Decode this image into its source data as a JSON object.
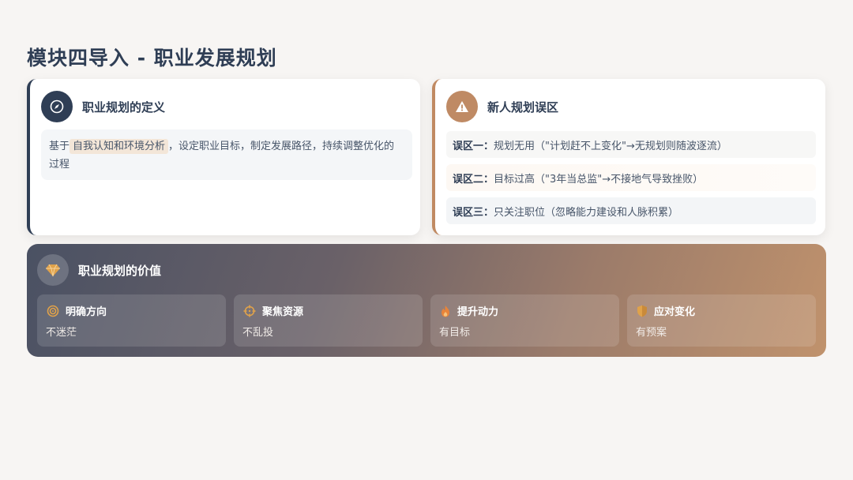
{
  "title": "模块四导入 - 职业发展规划",
  "definition": {
    "title": "职业规划的定义",
    "icon": "compass-icon",
    "text_before": "基于",
    "highlight": "自我认知和环境分析",
    "text_after": "，设定职业目标，制定发展路径，持续调整优化的过程"
  },
  "mistakes": {
    "title": "新人规划误区",
    "icon": "warning-icon",
    "items": [
      {
        "label": "误区一：",
        "text": "规划无用（\"计划赶不上变化\"→无规划则随波逐流）"
      },
      {
        "label": "误区二：",
        "text": "目标过高（\"3年当总监\"→不接地气导致挫败）"
      },
      {
        "label": "误区三：",
        "text": "只关注职位（忽略能力建设和人脉积累）"
      }
    ]
  },
  "value": {
    "title": "职业规划的价值",
    "icon": "gem-icon",
    "items": [
      {
        "title": "明确方向",
        "sub": "不迷茫",
        "icon": "target-icon"
      },
      {
        "title": "聚焦资源",
        "sub": "不乱投",
        "icon": "crosshair-icon"
      },
      {
        "title": "提升动力",
        "sub": "有目标",
        "icon": "flame-icon"
      },
      {
        "title": "应对变化",
        "sub": "有预案",
        "icon": "shield-icon"
      }
    ]
  },
  "colors": {
    "navy": "#2f3e55",
    "tan": "#bf8a64",
    "highlight_bg": "#f3e6d8",
    "icon_gold": "#e0a24a"
  }
}
